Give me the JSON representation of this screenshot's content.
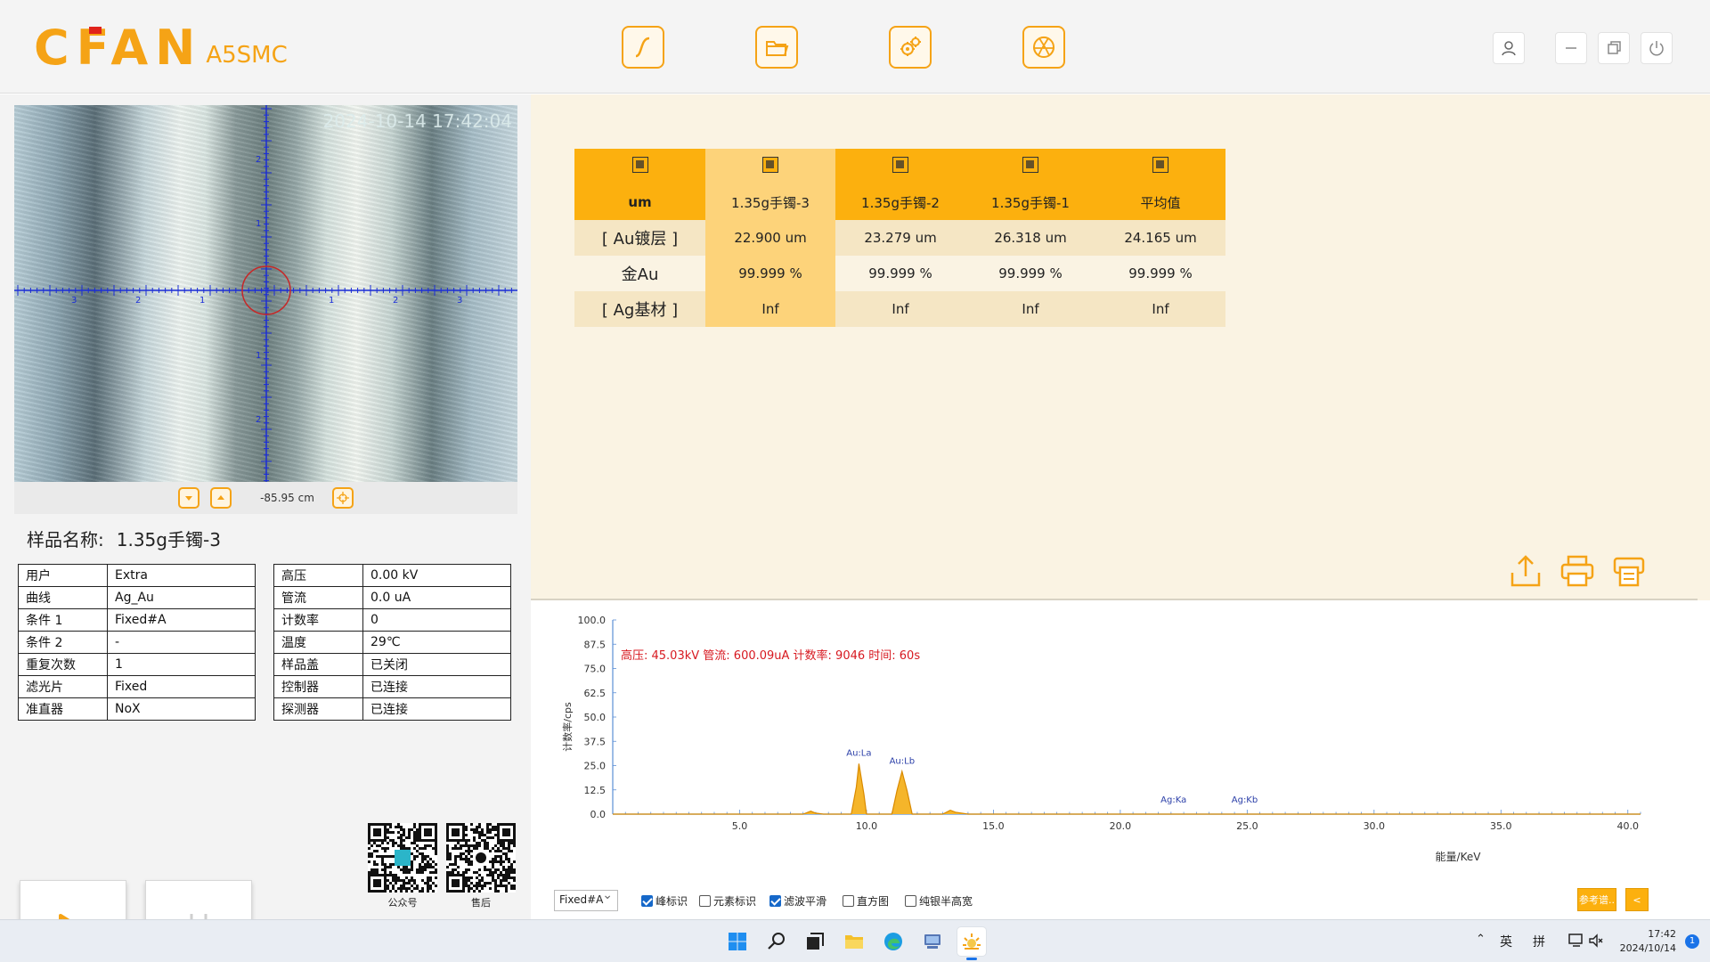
{
  "app": {
    "logo_main": "CFAN",
    "logo_sub": "A5SMC"
  },
  "toolbar": {
    "icons": [
      "curve-icon",
      "folder-open-icon",
      "settings-gears-icon",
      "radiation-icon"
    ]
  },
  "window_controls": [
    "user-icon",
    "minimize-icon",
    "restore-icon",
    "power-icon"
  ],
  "camera": {
    "timestamp": "2024-10-14 17:42:04",
    "focus_value": "-85.95 cm",
    "x_ticks": [
      "3",
      "2",
      "1",
      "1",
      "2",
      "3"
    ],
    "y_ticks": [
      "2",
      "1",
      "1",
      "2"
    ]
  },
  "sample": {
    "label": "样品名称:",
    "value": "1.35g手镯-3"
  },
  "params_left": [
    {
      "k": "用户",
      "v": "Extra"
    },
    {
      "k": "曲线",
      "v": "Ag_Au"
    },
    {
      "k": "条件 1",
      "v": "Fixed#A"
    },
    {
      "k": "条件 2",
      "v": "-"
    },
    {
      "k": "重复次数",
      "v": "1"
    },
    {
      "k": "滤光片",
      "v": "Fixed"
    },
    {
      "k": "准直器",
      "v": "NoX"
    }
  ],
  "params_right": [
    {
      "k": "高压",
      "v": "0.00 kV"
    },
    {
      "k": "管流",
      "v": "0.0 uA"
    },
    {
      "k": "计数率",
      "v": "0"
    },
    {
      "k": "温度",
      "v": "29℃"
    },
    {
      "k": "样品盖",
      "v": "已关闭"
    },
    {
      "k": "控制器",
      "v": "已连接"
    },
    {
      "k": "探测器",
      "v": "已连接"
    }
  ],
  "qr": {
    "left_label": "公众号",
    "right_label": "售后"
  },
  "counter_digit": "0",
  "results": {
    "unit": "um",
    "columns": [
      "1.35g手镯-3",
      "1.35g手镯-2",
      "1.35g手镯-1",
      "平均值"
    ],
    "rows": [
      {
        "label": "[ Au镀层 ]",
        "values": [
          "22.900 um",
          "23.279 um",
          "26.318 um",
          "24.165 um"
        ]
      },
      {
        "label": "金Au",
        "values": [
          "99.999 %",
          "99.999 %",
          "99.999 %",
          "99.999 %"
        ]
      },
      {
        "label": "[ Ag基材 ]",
        "values": [
          "Inf",
          "Inf",
          "Inf",
          "Inf"
        ]
      }
    ]
  },
  "chart_data": {
    "type": "line",
    "title": "",
    "annotation": "高压: 45.03kV  管流: 600.09uA  计数率: 9046  时间: 60s",
    "xlabel": "能量/KeV",
    "ylabel": "计数率/cps",
    "xlim": [
      0,
      40.5
    ],
    "ylim": [
      0,
      100
    ],
    "x_ticks": [
      "5.0",
      "10.0",
      "15.0",
      "20.0",
      "25.0",
      "30.0",
      "35.0",
      "40.0"
    ],
    "y_ticks": [
      "0.0",
      "12.5",
      "25.0",
      "37.5",
      "50.0",
      "62.5",
      "75.0",
      "87.5",
      "100.0"
    ],
    "series": [
      {
        "values_x": [
          0,
          7.5,
          7.8,
          8.0,
          8.3,
          9.4,
          9.6,
          9.7,
          9.9,
          10.0,
          10.3,
          11.0,
          11.2,
          11.4,
          11.6,
          11.8,
          12.2,
          13.0,
          13.3,
          13.5,
          14.0,
          40.5
        ],
        "values_y": [
          0,
          0,
          1.5,
          0.5,
          0,
          0,
          14,
          26,
          10,
          0,
          0,
          0,
          12,
          22,
          12,
          0,
          0,
          0,
          2,
          1,
          0,
          0
        ]
      }
    ],
    "peak_labels": [
      {
        "label": "Au:La",
        "x": 9.7,
        "y": 30
      },
      {
        "label": "Au:Lb",
        "x": 11.4,
        "y": 26
      },
      {
        "label": "Ag:Ka",
        "x": 22.1,
        "y": 6
      },
      {
        "label": "Ag:Kb",
        "x": 24.9,
        "y": 6
      }
    ],
    "line_color": "#d98a00",
    "fill_color": "#f5b52a",
    "annotation_color": "#d71920"
  },
  "spectrum_controls": {
    "condition": "Fixed#A",
    "checkboxes": [
      {
        "label": "峰标识",
        "checked": true
      },
      {
        "label": "元素标识",
        "checked": false
      },
      {
        "label": "滤波平滑",
        "checked": true
      },
      {
        "label": "直方图",
        "checked": false
      },
      {
        "label": "纯银半高宽",
        "checked": false
      }
    ],
    "ref_button": "参考谱..",
    "collapse_button": "<"
  },
  "taskbar": {
    "icons": [
      "windows-start-icon",
      "search-icon",
      "task-view-icon",
      "file-explorer-icon",
      "edge-browser-icon",
      "network-app-icon",
      "cfan-app-icon"
    ],
    "tray_lang": "英",
    "tray_ime": "拼",
    "time": "17:42",
    "date": "2024/10/14",
    "notifications": "1"
  },
  "colors": {
    "accent": "#f5a316",
    "table_header": "#fcb00e",
    "table_selected": "#fdd37a",
    "panel_bg": "#faf3e3",
    "peak_label": "#2b3fa8"
  }
}
